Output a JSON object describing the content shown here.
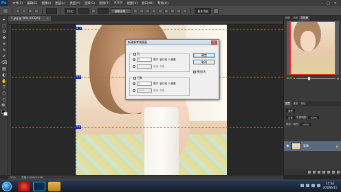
{
  "menubar": {
    "logo": "Ps",
    "items": [
      "文件(F)",
      "编辑(E)",
      "图像(I)",
      "图层(L)",
      "类型(Y)",
      "选择(S)",
      "滤镜(T)",
      "3D(D)",
      "视图(V)",
      "窗口(W)",
      "帮助(H)"
    ],
    "window_controls": [
      "–",
      "□",
      "✕"
    ]
  },
  "options": {
    "mode_select": "样式:",
    "align_button": "调整边缘...",
    "refine_button": "",
    "right_select": "基本功能"
  },
  "document_tab": {
    "label": "1.jpg @ 50% (RGB/8)",
    "close": "×"
  },
  "tools": [
    "▸",
    "⬚",
    "ʘ",
    "✥",
    "⌗",
    "✎",
    "✐",
    "⌫",
    "▤",
    "◐",
    "✋",
    "T",
    "⬡",
    "◻",
    "🔍"
  ],
  "guides": {
    "tags": [
      "X: 0",
      "Y: 0",
      "Y: 0",
      "Y: 0"
    ]
  },
  "dialog": {
    "title": "新建参考线版面",
    "close": "x",
    "columns_group": {
      "label": "列",
      "checked": true,
      "number_label": "数字",
      "number_value": "2",
      "gutter_label": "装订线",
      "gutter_value": "0 像素",
      "width_label": "宽度",
      "width_value": "",
      "width_unit": "像素"
    },
    "rows_group": {
      "label": "行数",
      "checked": true,
      "number_label": "数字",
      "number_value": "1",
      "gutter_label": "装订线",
      "gutter_value": "0 像素",
      "height_label": "高度",
      "height_value": "1080",
      "height_unit": "像素"
    },
    "ok_button": "确定",
    "cancel_button": "取消",
    "preview_label": "预览(V)",
    "preview_checked": true
  },
  "right_panel": {
    "top_tabs": [
      "颜色",
      "色板",
      "导航器"
    ],
    "zoom_value": "50%",
    "layer_tabs": [
      "图层",
      "通道",
      "路径"
    ],
    "kind_label": "类型",
    "blend_mode": "正常",
    "opacity_label": "不透明度:",
    "opacity_value": "100%",
    "lock_label": "锁定:",
    "fill_label": "填充:",
    "fill_value": "100%",
    "layer_name": "背景",
    "layer_lock": "🔒"
  },
  "status": {
    "zoom": "50%",
    "doc": "文档:5.93M/5.93M"
  },
  "taskbar": {
    "time": "15:54",
    "date": "2018/6/11"
  },
  "colors": {
    "guide": "#00a0ff",
    "selection_box": "#ff2a2a",
    "ps_blue": "#31a8ff"
  }
}
